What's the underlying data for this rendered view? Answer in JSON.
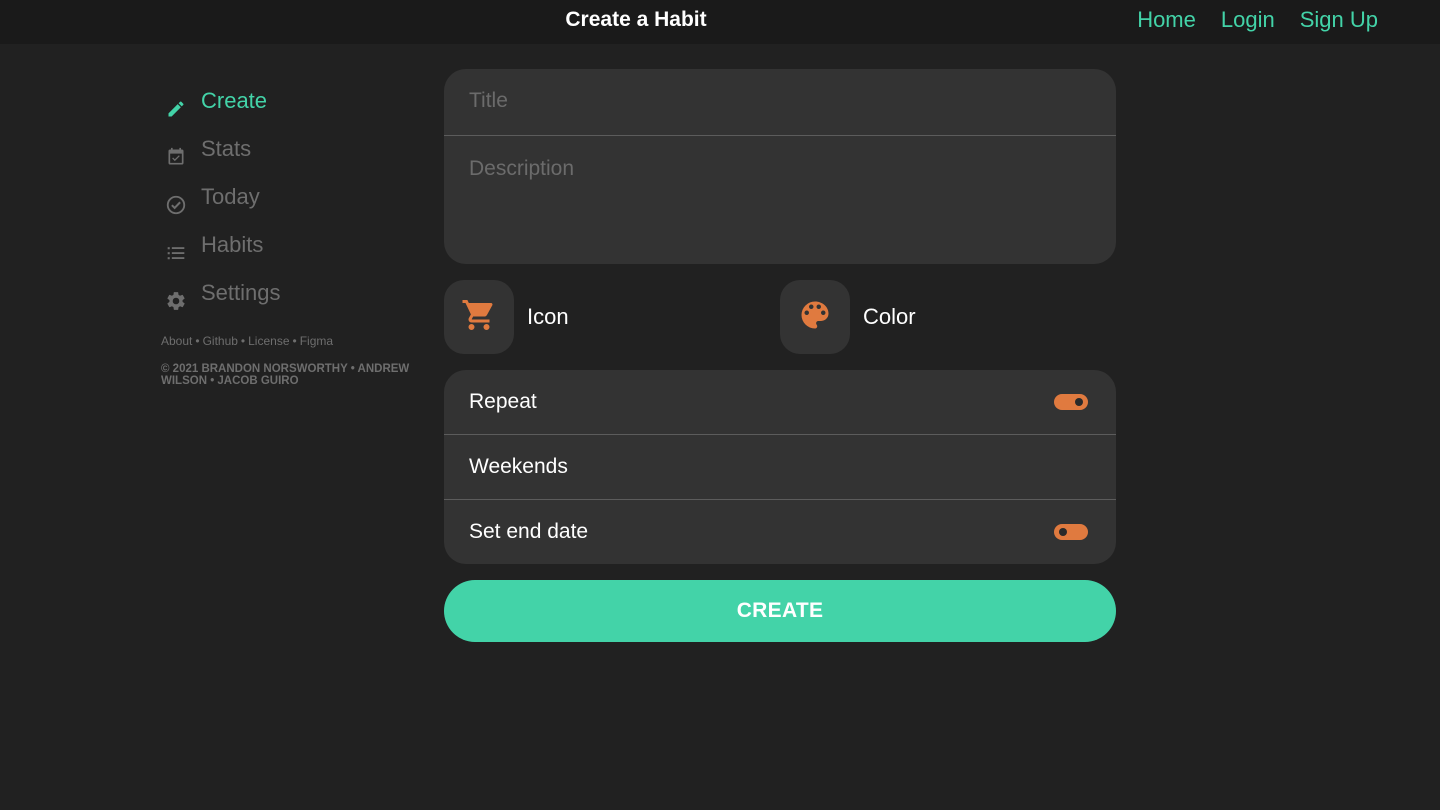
{
  "header": {
    "title": "Create a Habit",
    "nav": [
      {
        "label": "Home"
      },
      {
        "label": "Login"
      },
      {
        "label": "Sign Up"
      }
    ]
  },
  "sidebar": {
    "items": [
      {
        "label": "Create",
        "icon": "pencil-icon",
        "active": true
      },
      {
        "label": "Stats",
        "icon": "calendar-check-icon",
        "active": false
      },
      {
        "label": "Today",
        "icon": "check-circle-icon",
        "active": false
      },
      {
        "label": "Habits",
        "icon": "list-icon",
        "active": false
      },
      {
        "label": "Settings",
        "icon": "gear-icon",
        "active": false
      }
    ],
    "footer_links": [
      "About",
      "Github",
      "License",
      "Figma"
    ],
    "copyright": "© 2021 BRANDON NORSWORTHY • ANDREW WILSON • JACOB GUIRO"
  },
  "form": {
    "title_placeholder": "Title",
    "description_placeholder": "Description",
    "icon_label": "Icon",
    "icon_name": "cart-icon",
    "color_label": "Color",
    "color_icon_name": "palette-icon",
    "options": [
      {
        "label": "Repeat",
        "toggle": "on"
      },
      {
        "label": "Weekends",
        "toggle": null
      },
      {
        "label": "Set end date",
        "toggle": "off"
      }
    ],
    "submit_label": "CREATE"
  },
  "colors": {
    "accent": "#43d3a8",
    "secondary_accent": "#e07a3f",
    "background": "#212121",
    "card": "#333333"
  }
}
